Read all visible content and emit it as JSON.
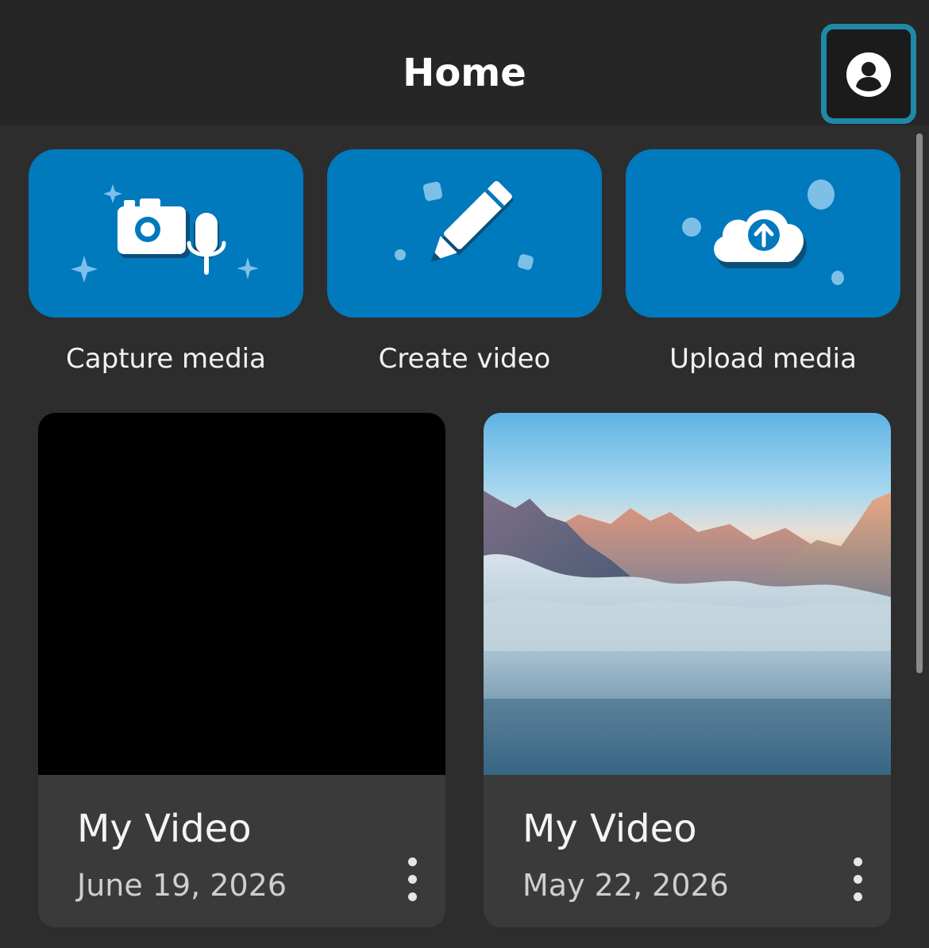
{
  "header": {
    "title": "Home",
    "account_icon": "account-circle-icon"
  },
  "actions": [
    {
      "label": "Capture media",
      "icon": "camera-microphone-icon"
    },
    {
      "label": "Create video",
      "icon": "pencil-icon"
    },
    {
      "label": "Upload media",
      "icon": "cloud-upload-icon"
    }
  ],
  "videos": [
    {
      "title": "My Video",
      "date": "June 19, 2026",
      "thumbnail": "black-thumbnail",
      "menu_icon": "more-vertical-icon"
    },
    {
      "title": "My Video",
      "date": "May 22, 2026",
      "thumbnail": "mountain-clouds-thumbnail",
      "menu_icon": "more-vertical-icon"
    }
  ],
  "colors": {
    "background": "#262626",
    "accent": "#0079bd",
    "focus_ring": "#1e8aa6",
    "card": "#3a3a3a"
  }
}
